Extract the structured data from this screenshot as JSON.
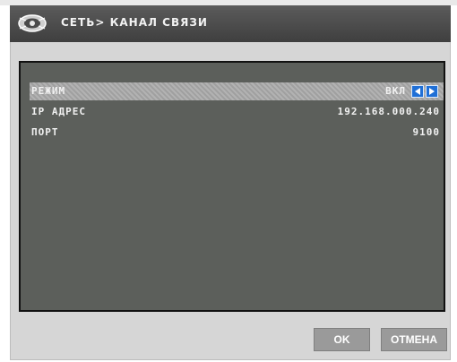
{
  "window": {
    "title": "СЕТЬ> КАНАЛ СВЯЗИ",
    "logo_icon": "dvr-logo-icon"
  },
  "settings": [
    {
      "label": "РЕЖИМ",
      "value": "ВКЛ",
      "selected": true,
      "has_arrows": true
    },
    {
      "label": "IP АДРЕС",
      "value": "192.168.000.240",
      "selected": false,
      "has_arrows": false
    },
    {
      "label": "ПОРТ",
      "value": "9100",
      "selected": false,
      "has_arrows": false
    }
  ],
  "buttons": {
    "ok_label": "OK",
    "cancel_label": "ОТМЕНА"
  },
  "colors": {
    "panel_background": "#5c5f5b",
    "selected_row": "#a9a9a9",
    "arrow_button": "#1f6fd6",
    "button_background": "#9a9a9a"
  }
}
